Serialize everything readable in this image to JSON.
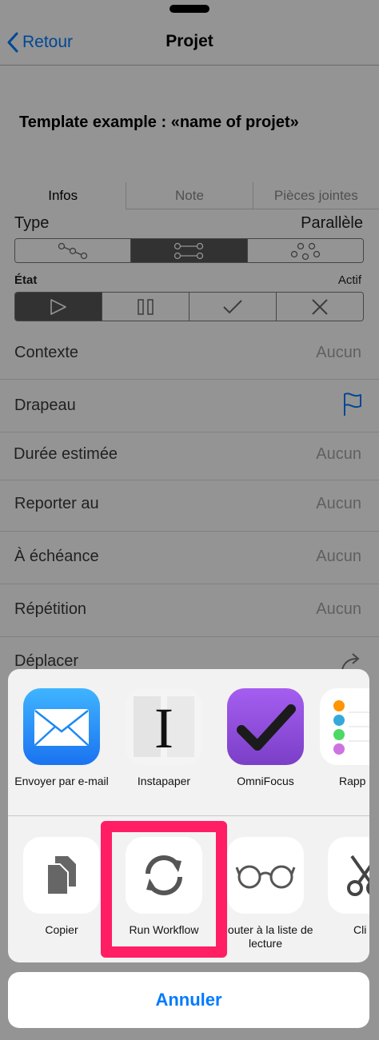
{
  "nav": {
    "back_label": "Retour",
    "title": "Projet"
  },
  "project_title": "Template example : «name of projet»",
  "tabs": [
    {
      "label": "Infos"
    },
    {
      "label": "Note"
    },
    {
      "label": "Pièces jointes"
    }
  ],
  "type": {
    "label": "Type",
    "value": "Parallèle"
  },
  "etat": {
    "label": "État",
    "value": "Actif"
  },
  "rows": [
    {
      "label": "Contexte",
      "value": "Aucun"
    },
    {
      "label": "Drapeau",
      "icon": "flag-icon"
    },
    {
      "label": "Durée estimée",
      "value": "Aucun"
    },
    {
      "label": "Reporter au",
      "value": "Aucun"
    },
    {
      "label": "À échéance",
      "value": "Aucun"
    },
    {
      "label": "Répétition",
      "value": "Aucun"
    },
    {
      "label": "Déplacer",
      "icon": "move-icon"
    }
  ],
  "share_apps": [
    {
      "label": "Envoyer par e-mail",
      "icon": "mail-icon",
      "color": "#1a8cf7"
    },
    {
      "label": "Instapaper",
      "icon": "instapaper-icon"
    },
    {
      "label": "OmniFocus",
      "icon": "omnifocus-icon",
      "color": "#8e4fd6"
    },
    {
      "label": "Rapp",
      "icon": "reminders-icon"
    }
  ],
  "share_actions": [
    {
      "label": "Copier",
      "icon": "copy-icon"
    },
    {
      "label": "Run Workflow",
      "icon": "workflow-icon"
    },
    {
      "label": "Ajouter à la liste de lecture",
      "icon": "glasses-icon"
    },
    {
      "label": "Cli",
      "icon": "scissors-icon"
    }
  ],
  "cancel_label": "Annuler",
  "accent_color": "#007aff",
  "highlight_color": "#ff1e63"
}
